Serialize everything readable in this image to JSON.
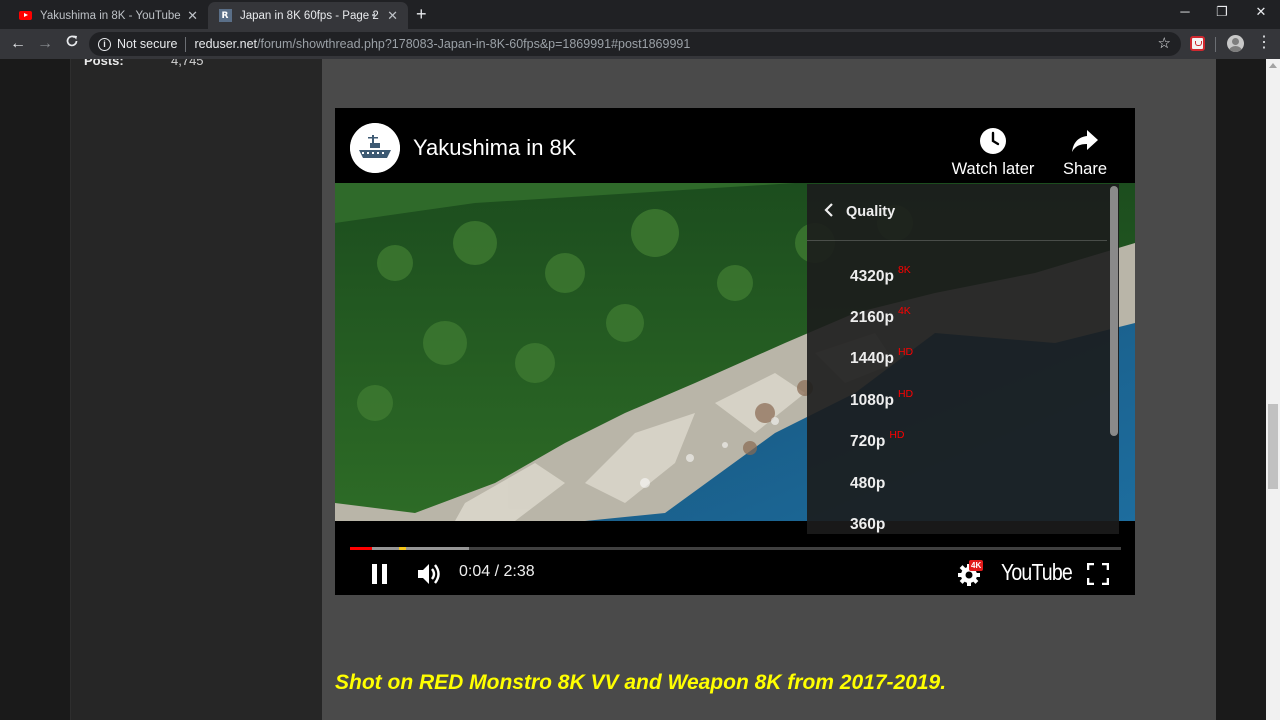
{
  "browser": {
    "tabs": [
      {
        "title": "Yakushima in 8K - YouTube",
        "favicon": "youtube-icon",
        "active": false
      },
      {
        "title": "Japan in 8K 60fps - Page 2",
        "favicon": "reduser-icon",
        "active": true,
        "audio": true
      }
    ],
    "security_label": "Not secure",
    "url_host": "reduser.net",
    "url_path": "/forum/showthread.php?178083-Japan-in-8K-60fps&p=1869991#post1869991"
  },
  "forum": {
    "posts_label": "Posts:",
    "posts_value": "4,745",
    "caption": "Shot on RED Monstro 8K VV and Weapon 8K from 2017-2019."
  },
  "player": {
    "title": "Yakushima in 8K",
    "watch_later_label": "Watch later",
    "share_label": "Share",
    "time": "0:04 / 2:38",
    "progress_played_fraction": 0.028,
    "progress_buffered_fraction": 0.154,
    "settings_badge": "4K",
    "brand": "YouTube",
    "quality_menu": {
      "title": "Quality",
      "items": [
        {
          "label": "4320p",
          "badge": "8K"
        },
        {
          "label": "2160p",
          "badge": "4K"
        },
        {
          "label": "1440p",
          "badge": "HD"
        },
        {
          "label": "1080p",
          "badge": "HD"
        },
        {
          "label": "720p",
          "badge": "HD"
        },
        {
          "label": "480p",
          "badge": ""
        },
        {
          "label": "360p",
          "badge": ""
        }
      ]
    }
  },
  "colors": {
    "accent_red": "#ff0000",
    "caption_yellow": "#ffff00",
    "post_background": "#4a4a4a"
  }
}
